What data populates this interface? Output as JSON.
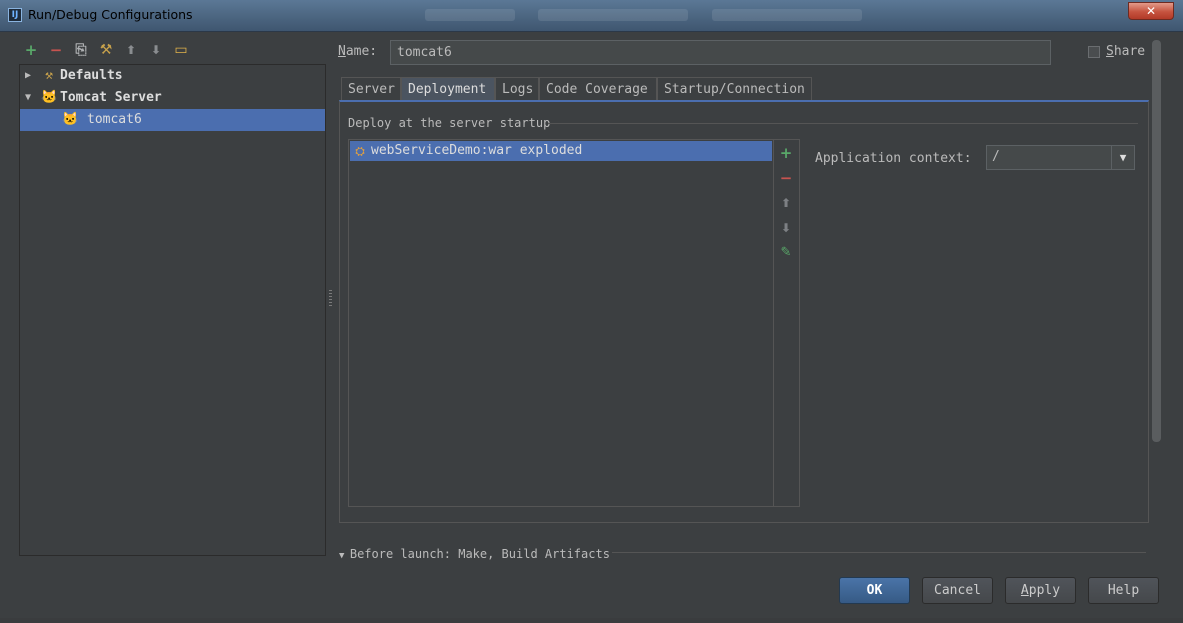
{
  "window": {
    "title": "Run/Debug Configurations",
    "app_icon": "IJ",
    "close_label": "✕"
  },
  "left_toolbar": [
    {
      "name": "add-icon",
      "glyph": "+",
      "color": "#59a869"
    },
    {
      "name": "remove-icon",
      "glyph": "−",
      "color": "#c75450"
    },
    {
      "name": "copy-icon",
      "glyph": "⎘",
      "color": "#afb1b3"
    },
    {
      "name": "edit-defaults-icon",
      "glyph": "⚒",
      "color": "#c8a24c"
    },
    {
      "name": "move-up-icon",
      "glyph": "⬆",
      "color": "#8a8d90"
    },
    {
      "name": "move-down-icon",
      "glyph": "⬇",
      "color": "#8a8d90"
    },
    {
      "name": "folder-icon",
      "glyph": "▭",
      "color": "#e0b24a"
    }
  ],
  "tree": {
    "defaults": "Defaults",
    "tomcat_server": "Tomcat Server",
    "tomcat6": "tomcat6"
  },
  "form": {
    "name_label": "Name:",
    "name_value": "tomcat6",
    "share_label": "Share"
  },
  "tabs": [
    "Server",
    "Deployment",
    "Logs",
    "Code Coverage",
    "Startup/Connection"
  ],
  "active_tab": "Deployment",
  "deployment": {
    "header": "Deploy at the server startup",
    "artifacts": [
      "webServiceDemo:war exploded"
    ],
    "context_label": "Application context:",
    "context_value": "/"
  },
  "before_launch": "Before launch: Make, Build Artifacts",
  "buttons": {
    "ok": "OK",
    "cancel": "Cancel",
    "apply": "Apply",
    "help": "Help"
  },
  "colors": {
    "selection": "#4b6eaf",
    "add_green": "#59a869",
    "remove_red": "#c75450"
  }
}
